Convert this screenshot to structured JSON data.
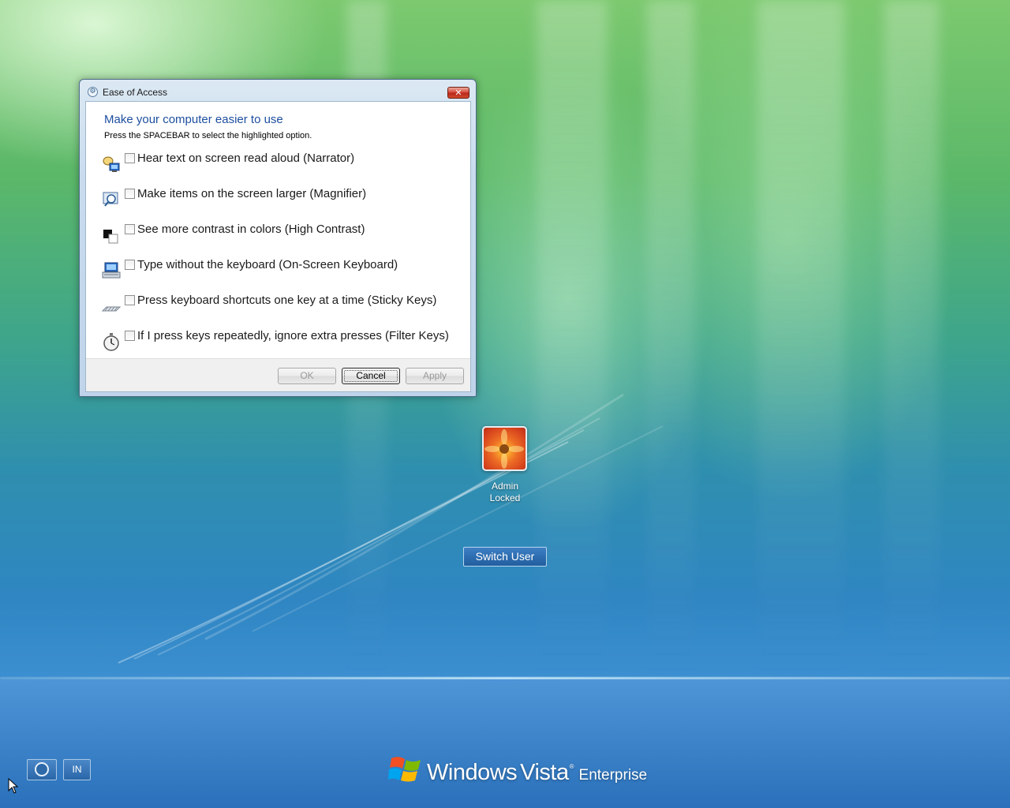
{
  "dialog": {
    "title": "Ease of Access",
    "close_glyph": "✕",
    "heading": "Make your computer easier to use",
    "instruction": "Press the SPACEBAR to select the highlighted option.",
    "options": [
      {
        "label": "Hear text on screen read aloud (Narrator)",
        "checked": false,
        "icon": "narrator-icon"
      },
      {
        "label": "Make items on the screen larger (Magnifier)",
        "checked": false,
        "icon": "magnifier-icon"
      },
      {
        "label": "See more contrast in colors (High Contrast)",
        "checked": false,
        "icon": "high-contrast-icon"
      },
      {
        "label": "Type without the keyboard (On-Screen Keyboard)",
        "checked": false,
        "icon": "on-screen-keyboard-icon"
      },
      {
        "label": "Press keyboard shortcuts one key at a time (Sticky Keys)",
        "checked": false,
        "icon": "sticky-keys-icon"
      },
      {
        "label": "If I press keys repeatedly, ignore extra presses (Filter Keys)",
        "checked": false,
        "icon": "filter-keys-icon"
      }
    ],
    "buttons": {
      "ok": "OK",
      "cancel": "Cancel",
      "apply": "Apply"
    }
  },
  "user": {
    "name": "Admin",
    "status": "Locked"
  },
  "switch_user_label": "Switch User",
  "language_indicator": "IN",
  "branding": {
    "windows": "Windows",
    "vista": "Vista",
    "tm": "®",
    "edition": "Enterprise"
  },
  "colors": {
    "heading_blue": "#1e4fa0",
    "close_red": "#d6493a",
    "desktop_green": "#5bb869",
    "desktop_blue": "#2f86c2"
  }
}
